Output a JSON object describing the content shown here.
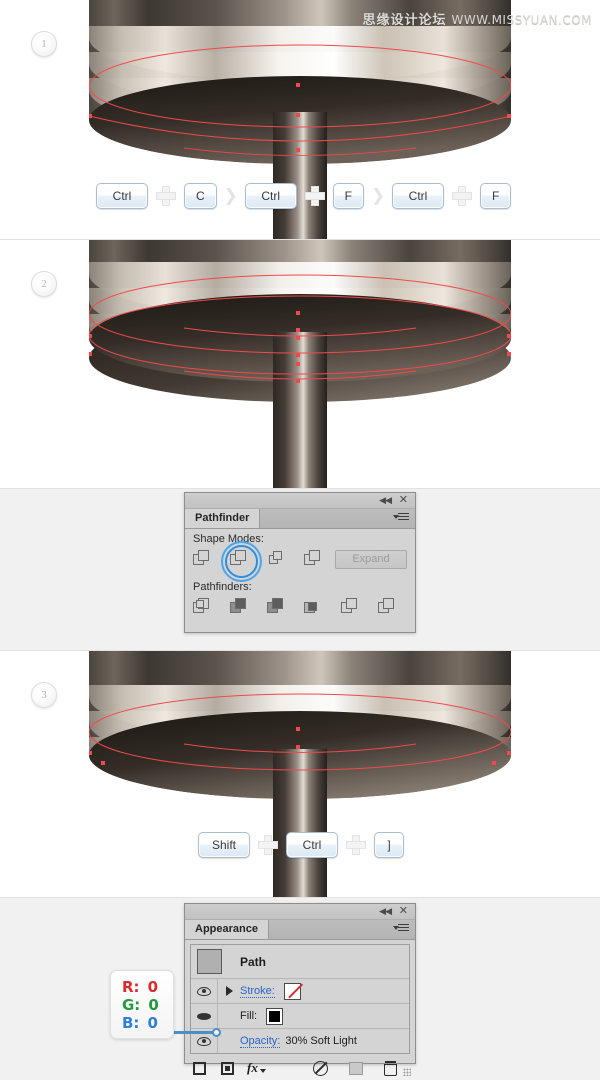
{
  "watermark": {
    "cn": "思缘设计论坛",
    "url": "WWW.MISSYUAN.COM"
  },
  "steps": [
    {
      "number": "1"
    },
    {
      "number": "2"
    },
    {
      "number": "3"
    }
  ],
  "shortcuts": {
    "step1": {
      "keys": [
        "Ctrl",
        "C",
        "Ctrl",
        "F",
        "Ctrl",
        "F"
      ],
      "separator_arrow": "❯"
    },
    "step3": {
      "keys": [
        "Shift",
        "Ctrl",
        "]"
      ]
    }
  },
  "pathfinder_panel": {
    "title": "Pathfinder",
    "shape_modes_label": "Shape Modes:",
    "pathfinders_label": "Pathfinders:",
    "expand_label": "Expand",
    "close_label": "✕",
    "collapse_label": "◀◀",
    "shape_modes": [
      {
        "name": "unite",
        "selected": false
      },
      {
        "name": "minus-front",
        "selected": true
      },
      {
        "name": "intersect",
        "selected": false
      },
      {
        "name": "exclude",
        "selected": false
      }
    ],
    "pathfinders": [
      {
        "name": "divide"
      },
      {
        "name": "trim"
      },
      {
        "name": "merge"
      },
      {
        "name": "crop"
      },
      {
        "name": "outline"
      },
      {
        "name": "minus-back"
      }
    ]
  },
  "appearance_panel": {
    "title": "Appearance",
    "close_label": "✕",
    "collapse_label": "◀◀",
    "object_label": "Path",
    "rows": [
      {
        "label": "Stroke:",
        "value": "",
        "swatch": "none",
        "visible": true,
        "expandable": true,
        "selected": false
      },
      {
        "label": "Fill:",
        "value": "",
        "swatch": "black",
        "visible": true,
        "expandable": false,
        "selected": true
      },
      {
        "label": "Opacity:",
        "value": "30% Soft Light",
        "swatch": "",
        "visible": true,
        "expandable": false,
        "selected": false
      }
    ],
    "toolbar": [
      {
        "name": "add-new-stroke"
      },
      {
        "name": "add-new-fill"
      },
      {
        "name": "add-new-effect"
      },
      {
        "name": "clear-appearance"
      },
      {
        "name": "duplicate-item"
      },
      {
        "name": "delete-item"
      }
    ],
    "fx_label": "fx"
  },
  "rgb_callout": {
    "r_label": "R:",
    "r_value": "0",
    "g_label": "G:",
    "g_value": "0",
    "b_label": "B:",
    "b_value": "0",
    "colors": {
      "r": "#d92b2b",
      "g": "#219a3f",
      "b": "#2b7fd9"
    }
  },
  "theme": {
    "section_gray": "#f1f1f1",
    "section_white": "#ffffff",
    "panel_bg": "#d4d4d4",
    "path_stroke_red": "#f04a4a",
    "accent_blue": "#2f8fe0"
  }
}
